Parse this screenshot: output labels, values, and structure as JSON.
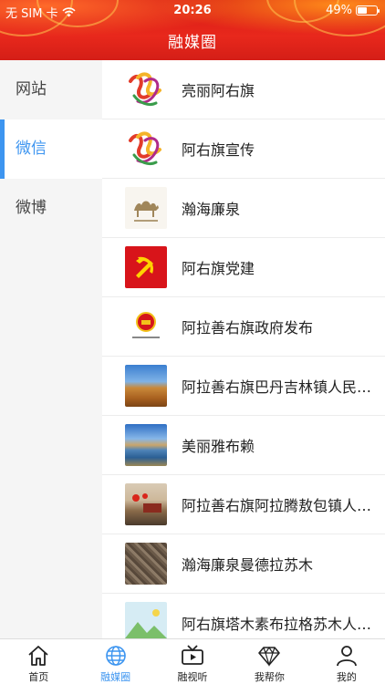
{
  "status_bar": {
    "carrier": "无 SIM 卡",
    "time": "20:26",
    "battery": "49%",
    "battery_level": 0.49
  },
  "header": {
    "title": "融媒圈"
  },
  "sidebar": {
    "items": [
      {
        "label": "网站",
        "active": false
      },
      {
        "label": "微信",
        "active": true
      },
      {
        "label": "微博",
        "active": false
      }
    ]
  },
  "list": {
    "items": [
      {
        "label": "亮丽阿右旗",
        "thumb": "ribbon-logo"
      },
      {
        "label": "阿右旗宣传",
        "thumb": "ribbon-logo"
      },
      {
        "label": "瀚海廉泉",
        "thumb": "camel-logo"
      },
      {
        "label": "阿右旗党建",
        "thumb": "party-emblem"
      },
      {
        "label": "阿拉善右旗政府发布",
        "thumb": "national-emblem"
      },
      {
        "label": "阿拉善右旗巴丹吉林镇人民…",
        "thumb": "desert-photo"
      },
      {
        "label": "美丽雅布赖",
        "thumb": "lake-photo"
      },
      {
        "label": "阿拉善右旗阿拉腾敖包镇人…",
        "thumb": "town-photo"
      },
      {
        "label": "瀚海廉泉曼德拉苏木",
        "thumb": "rock-photo"
      },
      {
        "label": "阿右旗塔木素布拉格苏木人…",
        "thumb": "placeholder-image"
      }
    ]
  },
  "tabbar": {
    "items": [
      {
        "label": "首页",
        "icon": "home-icon",
        "active": false
      },
      {
        "label": "融媒圈",
        "icon": "globe-icon",
        "active": true
      },
      {
        "label": "融视听",
        "icon": "tv-icon",
        "active": false
      },
      {
        "label": "我帮你",
        "icon": "diamond-icon",
        "active": false
      },
      {
        "label": "我的",
        "icon": "user-icon",
        "active": false
      }
    ]
  },
  "colors": {
    "accent": "#3d95f0",
    "header_red": "#e0241a"
  }
}
